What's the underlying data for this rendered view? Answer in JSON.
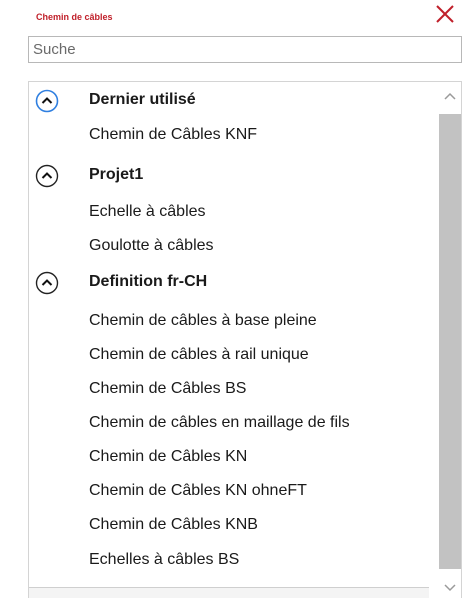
{
  "panel": {
    "title": "Chemin de câbles",
    "search_placeholder": "Suche"
  },
  "groups": [
    {
      "label": "Dernier utilisé",
      "items": [
        "Chemin de Câbles KNF"
      ]
    },
    {
      "label": "Projet1",
      "items": [
        "Echelle à câbles",
        "Goulotte à câbles"
      ]
    },
    {
      "label": "Definition fr-CH",
      "items": [
        "Chemin de câbles à base pleine",
        "Chemin de câbles à rail unique",
        "Chemin de Câbles BS",
        "Chemin de câbles en maillage de fils",
        "Chemin de Câbles KN",
        "Chemin de Câbles KN ohneFT",
        "Chemin de Câbles KNB",
        "Echelles à câbles BS"
      ]
    }
  ],
  "colors": {
    "title": "#c0202a",
    "focus_ring": "#2f7fe0",
    "scroll_thumb": "#c2c2c2"
  }
}
